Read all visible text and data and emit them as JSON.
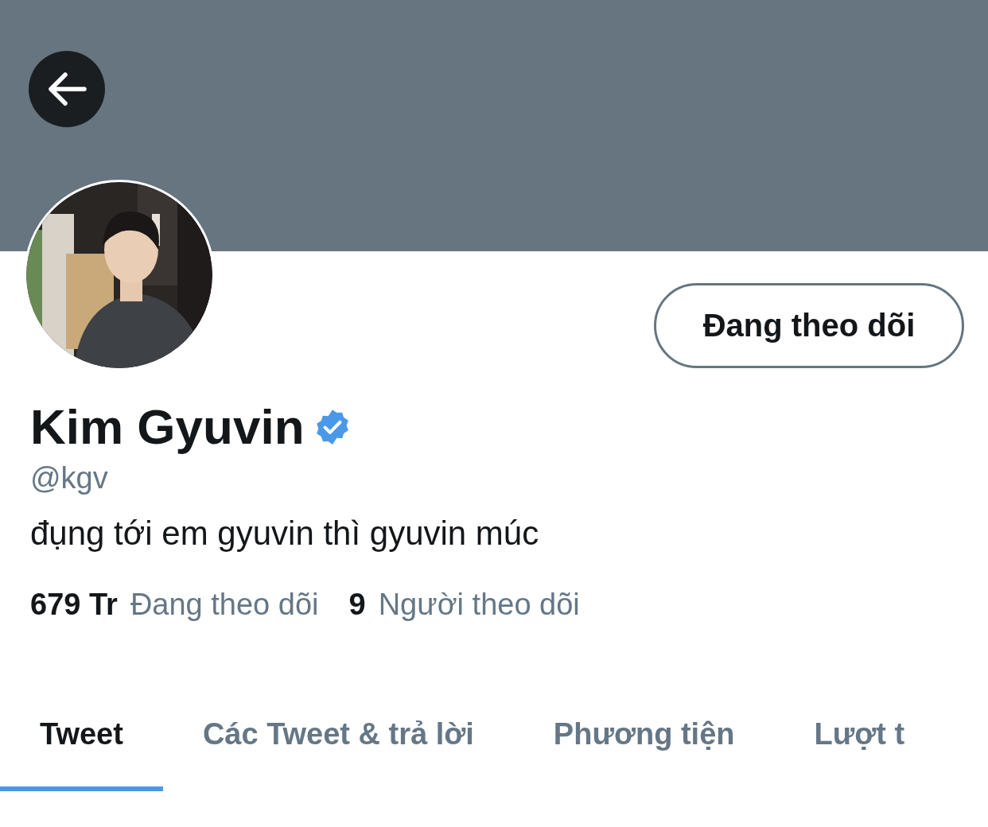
{
  "profile": {
    "name": "Kim Gyuvin",
    "verified": true,
    "handle": "@kgv",
    "bio": "đụng tới em gyuvin thì gyuvin múc",
    "follow_button": "Đang theo dõi"
  },
  "stats": [
    {
      "count": "679 Tr",
      "label": "Đang theo dõi"
    },
    {
      "count": "9",
      "label": "Người theo dõi"
    }
  ],
  "tabs": [
    {
      "label": "Tweet",
      "selected": true
    },
    {
      "label": "Các Tweet & trả lời",
      "selected": false
    },
    {
      "label": "Phương tiện",
      "selected": false
    },
    {
      "label": "Lượt t",
      "selected": false
    }
  ]
}
